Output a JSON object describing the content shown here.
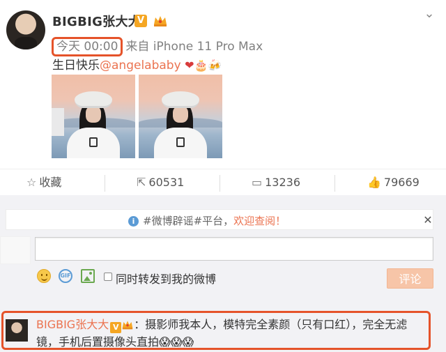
{
  "post": {
    "username": "BIGBIG张大大",
    "verified_badge": "V",
    "time": "今天 00:00",
    "source": "来自 iPhone 11 Pro Max",
    "text_prefix": "生日快乐",
    "mention": "@angelababy",
    "emojis": "❤🎂🍻",
    "images": [
      "photo-woman-bucket-hat-harbor-1",
      "photo-woman-bucket-hat-harbor-2"
    ]
  },
  "actions": {
    "favorite": "收藏",
    "repost": "60531",
    "comment": "13236",
    "like": "79669"
  },
  "notice": {
    "text": "#微博辟谣#平台，",
    "link": "欢迎查阅！"
  },
  "composer": {
    "input_value": "",
    "repost_label": "同时转发到我的微博",
    "submit_label": "评论"
  },
  "comment": {
    "username": "BIGBIG张大大",
    "verified_badge": "V",
    "text": "：摄影师我本人，模特完全素颜（只有口红），完全无滤镜，手机后置摄像头直拍",
    "emojis": "😱😱😱"
  },
  "colors": {
    "accent_orange": "#eb7350",
    "highlight_red": "#e5532a",
    "badge_gold": "#f5a623"
  }
}
